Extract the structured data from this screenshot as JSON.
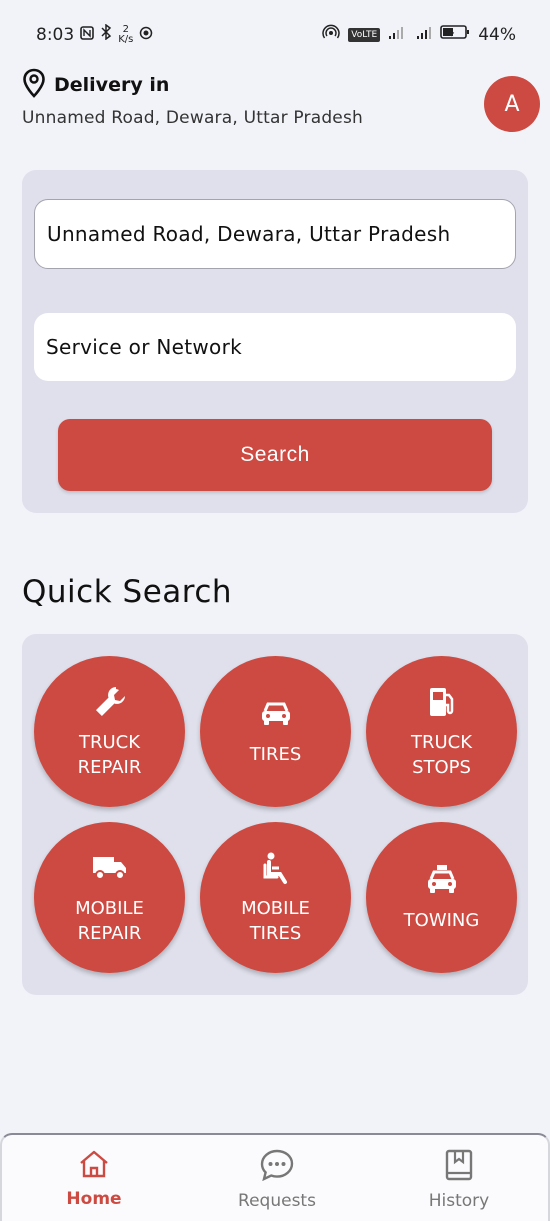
{
  "status_bar": {
    "time": "8:03",
    "net_speed_value": "2",
    "net_speed_unit": "K/s",
    "volte_label": "VoLTE",
    "battery": "44%"
  },
  "header": {
    "delivery_label": "Delivery in",
    "address": "Unnamed Road, Dewara, Uttar Pradesh",
    "avatar_initial": "A"
  },
  "search": {
    "address_value": "Unnamed Road, Dewara, Uttar Pradesh",
    "service_value": "Service or Network",
    "button_label": "Search"
  },
  "quick_search": {
    "title": "Quick Search",
    "items": [
      {
        "label": "TRUCK\nREPAIR",
        "icon": "wrench-icon"
      },
      {
        "label": "TIRES",
        "icon": "car-icon"
      },
      {
        "label": "TRUCK\nSTOPS",
        "icon": "gas-pump-icon"
      },
      {
        "label": "MOBILE\nREPAIR",
        "icon": "truck-icon"
      },
      {
        "label": "MOBILE\nTIRES",
        "icon": "seat-person-icon"
      },
      {
        "label": "TOWING",
        "icon": "taxi-icon"
      }
    ]
  },
  "nav": {
    "home": "Home",
    "requests": "Requests",
    "history": "History"
  },
  "colors": {
    "accent": "#cc4a41",
    "card_bg": "#dfe0ec",
    "page_bg": "#f2f3f8"
  }
}
